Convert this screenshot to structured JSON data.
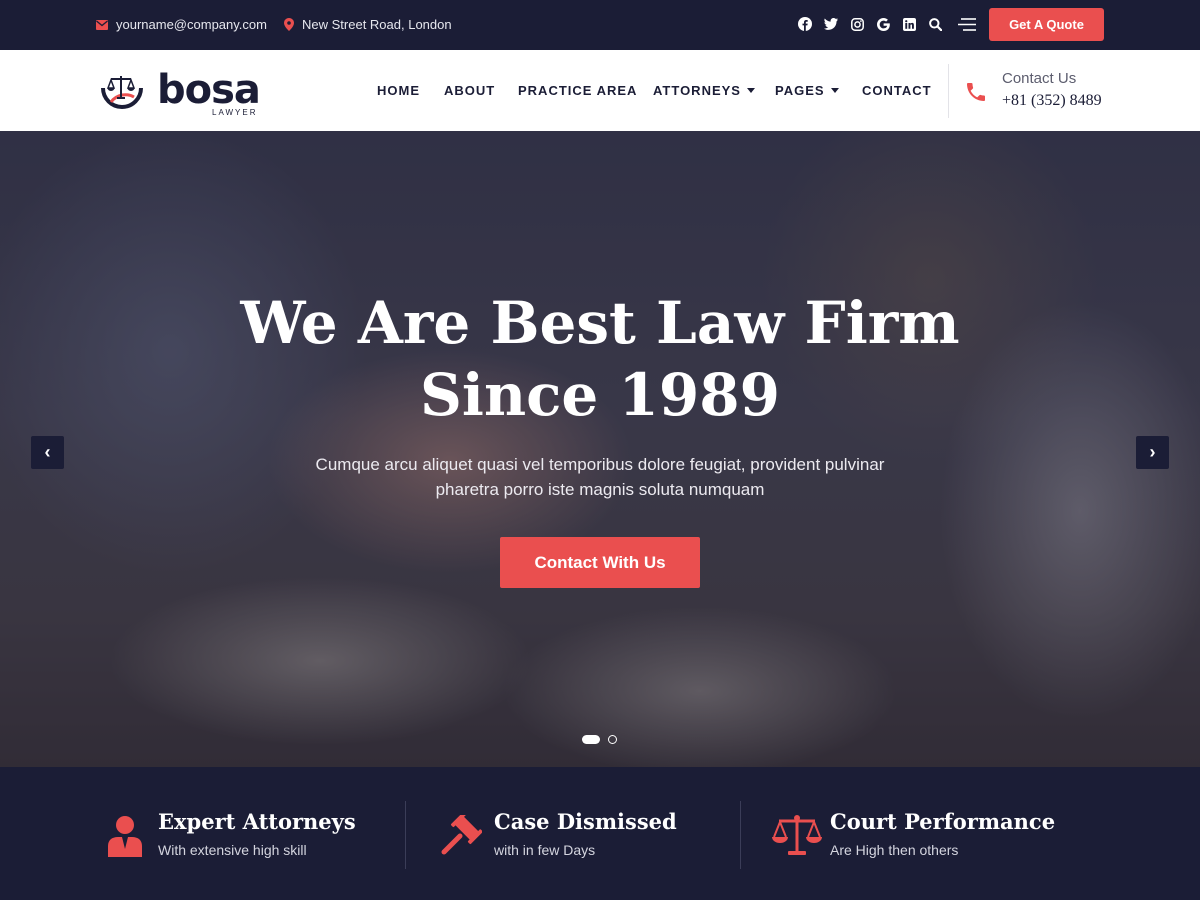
{
  "topbar": {
    "email": "yourname@company.com",
    "address": "New Street Road, London",
    "social_icons": [
      "facebook-icon",
      "twitter-icon",
      "instagram-icon",
      "google-icon",
      "linkedin-icon",
      "search-icon",
      "menu-icon"
    ],
    "quote_button": "Get A Quote"
  },
  "header": {
    "logo_text": "bosa",
    "logo_subtext": "LAWYER",
    "nav": [
      {
        "label": "HOME"
      },
      {
        "label": "ABOUT"
      },
      {
        "label": "PRACTICE AREA"
      },
      {
        "label": "ATTORNEYS"
      },
      {
        "label": "PAGES"
      },
      {
        "label": "CONTACT"
      }
    ],
    "contact_label": "Contact Us",
    "contact_number": "+81 (352) 8489"
  },
  "hero": {
    "title_line1": "We Are Best Law Firm",
    "title_line2": "Since 1989",
    "subtitle_line1": "Cumque arcu aliquet quasi vel temporibus dolore feugiat, provident pulvinar",
    "subtitle_line2": "pharetra porro iste magnis soluta numquam",
    "cta_label": "Contact With Us",
    "prev_label": "‹",
    "next_label": "›",
    "slides_total": 2,
    "slide_active": 1
  },
  "features": [
    {
      "title": "Expert Attorneys",
      "desc": "With extensive high skill",
      "icon": "attorney-icon"
    },
    {
      "title": "Case Dismissed",
      "desc": "with in few Days",
      "icon": "gavel-icon"
    },
    {
      "title": "Court Performance",
      "desc": "Are High then others",
      "icon": "scales-icon"
    }
  ],
  "colors": {
    "accent": "#ea4f4f",
    "navy": "#1b1d36"
  }
}
